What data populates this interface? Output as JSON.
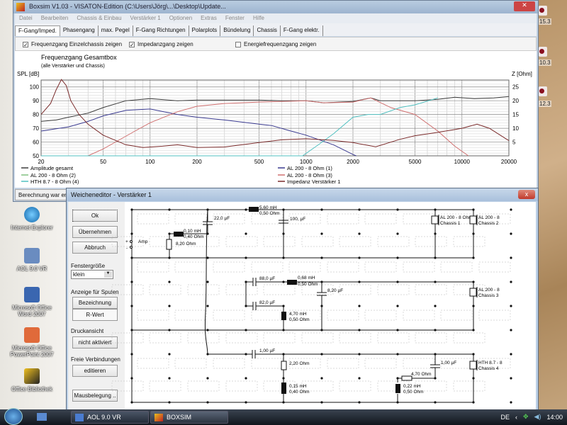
{
  "desktop": {
    "icons": [
      {
        "label": "Internet Explorer"
      },
      {
        "label": "AOL 9.0 VR"
      },
      {
        "label": "Microsoft Office Word 2007"
      },
      {
        "label": "Microsoft Office PowerPoint 2007"
      },
      {
        "label": "Office Bibliothek"
      }
    ],
    "right_labels": [
      "15.3",
      "10.3",
      "12.3"
    ]
  },
  "main": {
    "title": "Boxsim V1.03 - VISATON-Edition (C:\\Users\\Jörg\\...\\Desktop\\Update...",
    "menu": [
      "Datei",
      "Bearbeiten",
      "Chassis & Einbau",
      "Verstärker 1",
      "Optionen",
      "Extras",
      "Fenster",
      "Hilfe"
    ],
    "tabs": [
      "F-Gang/Imped.",
      "Phasengang",
      "max. Pegel",
      "F-Gang Richtungen",
      "Polarplots",
      "Bündelung",
      "Chassis",
      "F-Gang elektr."
    ],
    "checkboxes": [
      {
        "label": "Frequenzgang Einzelchassis zeigen",
        "checked": true
      },
      {
        "label": "Impedanzgang zeigen",
        "checked": true
      },
      {
        "label": "Energiefrequenzgang zeigen",
        "checked": false
      }
    ],
    "status": "Berechnung war erfo"
  },
  "chart_data": {
    "type": "line",
    "title": "Frequenzgang Gesamtbox",
    "subtitle": "(alle Verstärker und Chassis)",
    "ylabel": "SPL [dB]",
    "y2label": "Z [Ohm]",
    "xlabel": "",
    "xscale": "log",
    "xlim": [
      20,
      20000
    ],
    "ylim": [
      50,
      105
    ],
    "y2lim": [
      0,
      27.5
    ],
    "xticks": [
      "20",
      "50",
      "100",
      "200",
      "500",
      "1000",
      "2000",
      "5000",
      "10000",
      "20000"
    ],
    "yticks": [
      "50",
      "60",
      "70",
      "80",
      "90",
      "100"
    ],
    "y2ticks": [
      "5",
      "10",
      "15",
      "20",
      "25"
    ],
    "legend_position": "bottom",
    "series": [
      {
        "name": "Amplitude gesamt",
        "axis": "spl",
        "color": "#3c3c3c",
        "points": [
          [
            20,
            75
          ],
          [
            25,
            76
          ],
          [
            30,
            78
          ],
          [
            40,
            81
          ],
          [
            50,
            85
          ],
          [
            70,
            90
          ],
          [
            100,
            91.5
          ],
          [
            150,
            90
          ],
          [
            200,
            90.5
          ],
          [
            500,
            90.5
          ],
          [
            700,
            90
          ],
          [
            1000,
            90
          ],
          [
            1300,
            88.5
          ],
          [
            2000,
            89.5
          ],
          [
            2600,
            92
          ],
          [
            3000,
            90
          ],
          [
            5000,
            90
          ],
          [
            7000,
            91
          ],
          [
            9000,
            92.5
          ],
          [
            12000,
            91.5
          ],
          [
            16000,
            92
          ],
          [
            20000,
            93
          ]
        ]
      },
      {
        "name": "AL 200 - 8 Ohm (1)",
        "axis": "spl",
        "color": "#3a3a90",
        "points": [
          [
            20,
            68
          ],
          [
            30,
            71
          ],
          [
            40,
            75
          ],
          [
            50,
            79
          ],
          [
            70,
            83
          ],
          [
            100,
            84
          ],
          [
            150,
            80
          ],
          [
            200,
            78
          ],
          [
            300,
            76
          ],
          [
            500,
            73
          ],
          [
            600,
            72
          ],
          [
            800,
            68
          ],
          [
            1000,
            65
          ],
          [
            1500,
            58
          ],
          [
            2000,
            51
          ],
          [
            2100,
            50
          ]
        ]
      },
      {
        "name": "AL 200 - 8 Ohm (2)",
        "axis": "spl",
        "color": "#80c080",
        "points": []
      },
      {
        "name": "AL 200 - 8 Ohm (3)",
        "axis": "spl",
        "color": "#d07070",
        "points": [
          [
            20,
            50
          ],
          [
            40,
            50
          ],
          [
            50,
            55
          ],
          [
            60,
            60
          ],
          [
            80,
            68
          ],
          [
            100,
            74
          ],
          [
            150,
            82
          ],
          [
            200,
            86
          ],
          [
            300,
            88
          ],
          [
            500,
            89
          ],
          [
            700,
            89.5
          ],
          [
            1000,
            90
          ],
          [
            1300,
            88.5
          ],
          [
            2000,
            89
          ],
          [
            2600,
            92
          ],
          [
            3500,
            85
          ],
          [
            5000,
            80
          ],
          [
            7000,
            68
          ],
          [
            9000,
            57
          ],
          [
            11000,
            50
          ]
        ]
      },
      {
        "name": "HTH 8.7 - 8 Ohm (4)",
        "axis": "spl",
        "color": "#50c0c0",
        "points": [
          [
            20,
            50
          ],
          [
            950,
            50
          ],
          [
            1200,
            58
          ],
          [
            1500,
            66
          ],
          [
            2000,
            78
          ],
          [
            2500,
            80
          ],
          [
            3000,
            80
          ],
          [
            4000,
            85
          ],
          [
            5000,
            87
          ],
          [
            7000,
            92
          ]
        ]
      },
      {
        "name": "Impedanz Verstärker 1",
        "axis": "z",
        "color": "#7a2a2a",
        "points": [
          [
            20,
            15
          ],
          [
            23,
            19
          ],
          [
            25,
            24
          ],
          [
            27,
            27.7
          ],
          [
            29,
            25.5
          ],
          [
            31,
            20
          ],
          [
            35,
            15
          ],
          [
            40,
            11.5
          ],
          [
            50,
            7.5
          ],
          [
            70,
            4
          ],
          [
            90,
            3
          ],
          [
            120,
            3.5
          ],
          [
            150,
            4
          ],
          [
            200,
            3
          ],
          [
            300,
            3.2
          ],
          [
            500,
            4.8
          ],
          [
            700,
            5.8
          ],
          [
            1000,
            6.2
          ],
          [
            1500,
            5.6
          ],
          [
            2000,
            4.8
          ],
          [
            2800,
            3.3
          ],
          [
            4000,
            6
          ],
          [
            5000,
            7.3
          ],
          [
            7000,
            8.5
          ],
          [
            10000,
            10
          ],
          [
            12500,
            11.5
          ],
          [
            15000,
            10
          ],
          [
            20000,
            5.5
          ]
        ]
      }
    ]
  },
  "dialog": {
    "title": "Weicheneditor - Verstärker 1",
    "buttons": {
      "ok": "Ok",
      "apply": "Übernehmen",
      "cancel": "Abbruch"
    },
    "window_size_label": "Fenstergröße",
    "window_size_value": "klein",
    "coil_display_label": "Anzeige für Spulen",
    "coil_btn1": "Bezeichnung",
    "coil_btn2": "R-Wert",
    "print_label": "Druckansicht",
    "print_btn": "nicht aktiviert",
    "free_label": "Freie Verbindungen",
    "free_btn": "editieren",
    "mouse_btn": "Mausbelegung ..",
    "circuit": {
      "amp": "Amp",
      "plus": "+",
      "minus": "-",
      "c22": "22,0 µF",
      "l560": "5,60 mH",
      "l560r": "0,50 Ohm",
      "c100": "100, µF",
      "l010": "0,10 mH",
      "l010r": "0,40 Ohm",
      "r820": "8,20 Ohm",
      "ch1": "AL 200 - 8 Ohm",
      "ch1b": "Chassis 1",
      "ch2": "AL 200 - 8",
      "ch2b": "Chassis 2",
      "c88": "88,0 µF",
      "l068": "0,68 mH",
      "l068r": "0,50 Ohm",
      "c820": "8,20 µF",
      "c82": "82,0 µF",
      "l470": "4,70 mH",
      "l470r": "0,50 Ohm",
      "ch3": "AL 200 - 8",
      "ch3b": "Chassis 3",
      "c1a": "1,00 µF",
      "r220": "2,20 Ohm",
      "l015": "0,15 mH",
      "l015r": "0,40 Ohm",
      "r470": "4,70 Ohm",
      "c1b": "1,00 µF",
      "l022": "0,22 mH",
      "l022r": "0,50 Ohm",
      "ch4": "HTH 8.7 - 8",
      "ch4b": "Chassis 4"
    }
  },
  "taskbar": {
    "items": [
      "AOL 9.0 VR",
      "BOXSIM"
    ],
    "lang": "DE",
    "clock": "14:00"
  }
}
